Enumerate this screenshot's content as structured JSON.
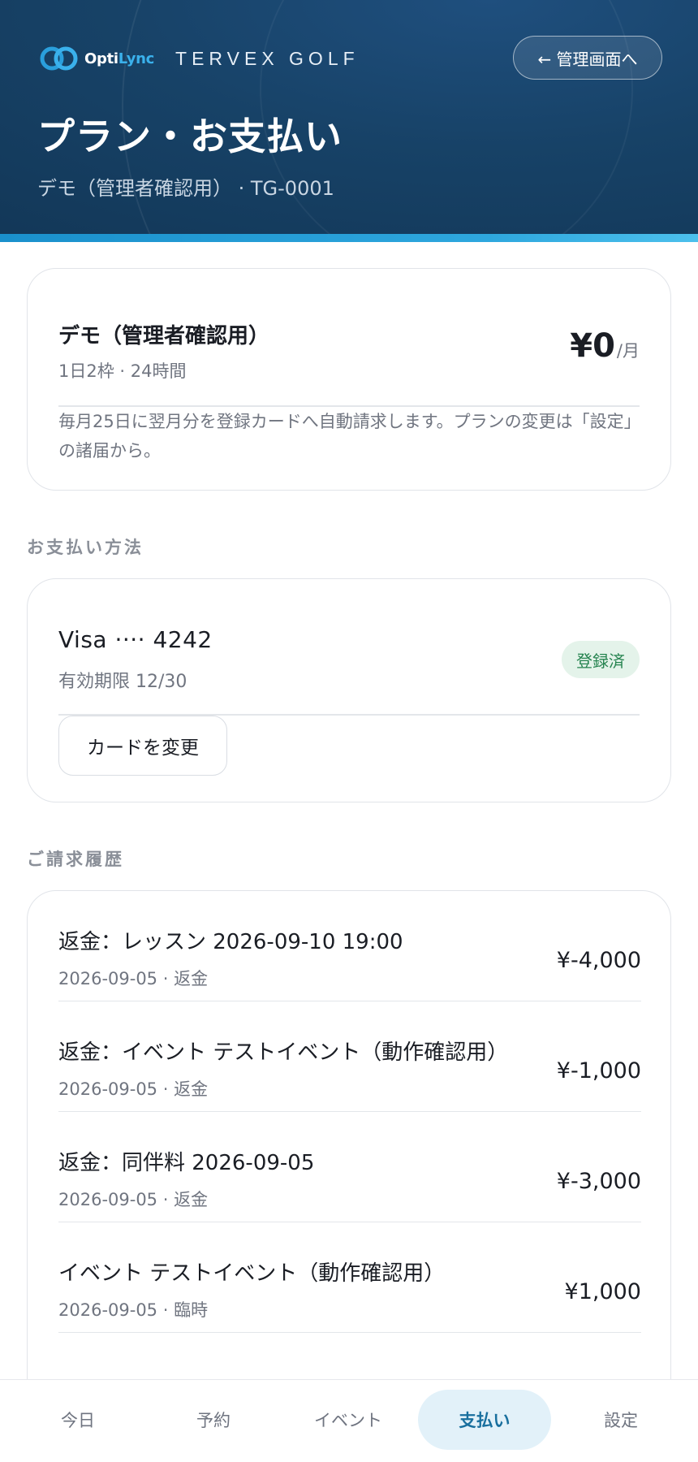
{
  "header": {
    "logo_prefix": "Opti",
    "logo_accent": "Lync",
    "store_name": "TERVEX GOLF",
    "back_button_label": "← 管理画面へ",
    "title": "プラン・お支払い",
    "subtitle": "デモ（管理者確認用） · TG-0001"
  },
  "plan": {
    "name": "デモ（管理者確認用）",
    "detail": "1日2枠 · 24時間",
    "price": "¥0",
    "price_unit": "/月",
    "note": "毎月25日に翌月分を登録カードへ自動請求します。プランの変更は「設定」の諸届から。"
  },
  "payment": {
    "section_label": "お支払い方法",
    "card_number": "Visa ···· 4242",
    "expiry": "有効期限 12/30",
    "status": "登録済",
    "change_button_label": "カードを変更"
  },
  "history": {
    "section_label": "ご請求履歴",
    "items": [
      {
        "title": "返金：レッスン 2026-09-10 19:00",
        "meta": "2026-09-05 · 返金",
        "amount": "¥-4,000"
      },
      {
        "title": "返金：イベント テストイベント（動作確認用）",
        "meta": "2026-09-05 · 返金",
        "amount": "¥-1,000"
      },
      {
        "title": "返金：同伴料 2026-09-05",
        "meta": "2026-09-05 · 返金",
        "amount": "¥-3,000"
      },
      {
        "title": "イベント テストイベント（動作確認用）",
        "meta": "2026-09-05 · 臨時",
        "amount": "¥1,000"
      }
    ]
  },
  "nav": {
    "items": [
      {
        "label": "今日"
      },
      {
        "label": "予約"
      },
      {
        "label": "イベント"
      },
      {
        "label": "支払い",
        "active": true
      },
      {
        "label": "設定"
      }
    ]
  },
  "colors": {
    "header_bg": "#174267",
    "accent": "#2ea7de",
    "badge_bg": "#e4f3ea",
    "badge_text": "#25834f",
    "nav_active_bg": "#e2f1f9",
    "nav_active_text": "#186f9e"
  },
  "icons": {
    "logo": "optilync-rings-logo"
  }
}
